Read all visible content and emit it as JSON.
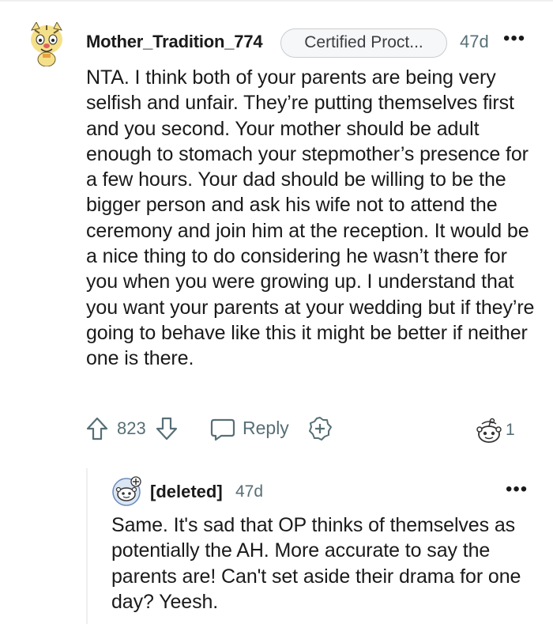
{
  "comment": {
    "username": "Mother_Tradition_774",
    "flair": "Certified Proct...",
    "time": "47d",
    "more": "•••",
    "body": "NTA. I think both of your parents are being very selfish and unfair. They’re putting themselves first and you second. Your mother should be adult enough to stomach your stepmother’s presence for a few hours. Your dad should be willing to be the bigger person and ask his wife not to attend the ceremony and join him at the reception. It would be a nice thing to do considering he wasn’t there for you when you were growing up. I understand that you want your parents at your wedding but if they’re going to behave like this it might be better if neither one is there.",
    "actions": {
      "upvote_icon": "arrow-up-icon",
      "score": "823",
      "downvote_icon": "arrow-down-icon",
      "reply_icon": "speech-bubble-icon",
      "reply_label": "Reply",
      "award_icon": "plus-badge-icon",
      "awards_icon": "snoo-award-icon",
      "awards_count": "1"
    }
  },
  "reply": {
    "username": "[deleted]",
    "time": "47d",
    "more": "•••",
    "body": "Same. It's sad that OP thinks of themselves as potentially the AH. More accurate to say the parents are! Can't set aside their drama for one day? Yeesh."
  },
  "colors": {
    "text": "#1a1a1b",
    "meta": "#576f76",
    "divider": "#edeff1",
    "flair_border": "#c9ccd0"
  }
}
